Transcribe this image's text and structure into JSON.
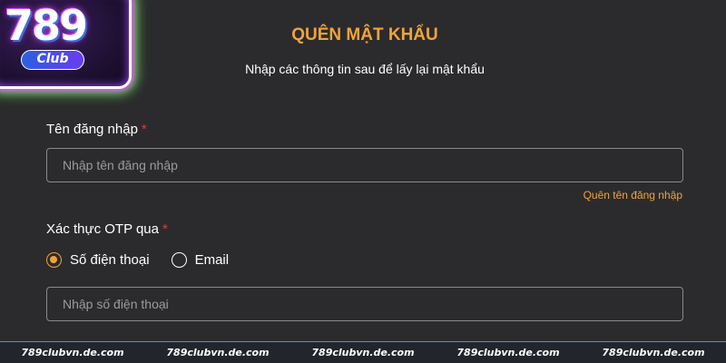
{
  "logo": {
    "main": "789",
    "sub": "Club"
  },
  "title": "QUÊN MẬT KHẨU",
  "subtitle": "Nhập các thông tin sau để lấy lại mật khẩu",
  "username": {
    "label": "Tên đăng nhập",
    "required_mark": "*",
    "placeholder": "Nhập tên đăng nhập",
    "forgot_link": "Quên tên đăng nhập"
  },
  "otp": {
    "label": "Xác thực OTP qua",
    "required_mark": "*",
    "options": [
      {
        "label": "Số điện thoại",
        "selected": true
      },
      {
        "label": "Email",
        "selected": false
      }
    ]
  },
  "phone": {
    "placeholder": "Nhập số điện thoại"
  },
  "watermark": [
    "789clubvn.de.com",
    "789clubvn.de.com",
    "789clubvn.de.com",
    "789clubvn.de.com",
    "789clubvn.de.com"
  ],
  "colors": {
    "accent": "#f0a33a",
    "required": "#e0393e",
    "background": "#2b2b2d"
  }
}
